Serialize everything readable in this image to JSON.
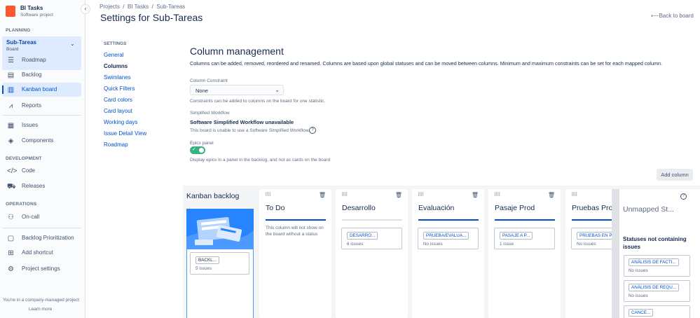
{
  "project": {
    "name": "BI Tasks",
    "type": "Software project"
  },
  "sidebar": {
    "planning_heading": "PLANNING",
    "board_name": "Sub-Tareas",
    "board_sub": "Board",
    "planning_items": [
      {
        "label": "Roadmap"
      },
      {
        "label": "Backlog"
      },
      {
        "label": "Kanban board"
      },
      {
        "label": "Reports"
      }
    ],
    "other_items": [
      {
        "label": "Issues"
      },
      {
        "label": "Components"
      }
    ],
    "development_heading": "DEVELOPMENT",
    "development_items": [
      {
        "label": "Code"
      },
      {
        "label": "Releases"
      }
    ],
    "operations_heading": "OPERATIONS",
    "operations_items": [
      {
        "label": "On-call"
      }
    ],
    "bottom_items": [
      {
        "label": "Backlog Prioritization"
      },
      {
        "label": "Add shortcut"
      },
      {
        "label": "Project settings"
      }
    ],
    "footer_text": "You're in a company-managed project",
    "learn_more": "Learn more"
  },
  "breadcrumbs": [
    "Projects",
    "BI Tasks",
    "Sub-Tareas"
  ],
  "page_title": "Settings for Sub-Tareas",
  "back_to_board": "Back to board",
  "settings_nav": {
    "heading": "SETTINGS",
    "items": [
      "General",
      "Columns",
      "Swimlanes",
      "Quick Filters",
      "Card colors",
      "Card layout",
      "Working days",
      "Issue Detail View",
      "Roadmap"
    ],
    "current": "Columns"
  },
  "content": {
    "heading": "Column management",
    "description": "Columns can be added, removed, reordered and renamed. Columns are based upon global statuses and can be moved between columns. Minimum and maximum constraints can be set for each mapped column.",
    "constraint_label": "Column Constraint",
    "constraint_value": "None",
    "constraint_help": "Constraints can be added to columns on the board for one statistic.",
    "workflow_label": "Simplified Workflow",
    "workflow_title": "Software Simplified Workflow unavailable",
    "workflow_help": "This board is unable to use a Software Simplified Workflow.",
    "epics_label": "Epics panel",
    "epics_enabled": true,
    "epics_help": "Display epics in a panel in the backlog, and not as cards on the board",
    "add_column": "Add column"
  },
  "board": {
    "backlog": {
      "title": "Kanban backlog",
      "status": "BACKL...",
      "count": "5 issues"
    },
    "columns": [
      {
        "title": "To Do",
        "note": "This column will not show on the board without a status"
      },
      {
        "title": "Desarrollo",
        "status": "DESARRO...",
        "count": "6 issues"
      },
      {
        "title": "Evaluación",
        "status": "PRUEBA/EVALUA...",
        "count": "No issues"
      },
      {
        "title": "Pasaje Prod",
        "status": "PASAJE A P...",
        "count": "1 issue"
      },
      {
        "title": "Pruebas Prod",
        "status": "PRUEBAS EN P...",
        "count": "No issues"
      }
    ],
    "unmapped": {
      "title": "Unmapped St...",
      "subtitle": "Statuses not containing issues",
      "statuses": [
        {
          "status": "ANÁLISIS DE FACTI...",
          "count": "No issues"
        },
        {
          "status": "ANÁLISIS DE REQU...",
          "count": "No issues"
        },
        {
          "status": "CANCE...",
          "count": ""
        }
      ]
    }
  },
  "icons": {
    "drag": "drag-handle-icon",
    "trash": "trash-icon",
    "help": "question-icon"
  },
  "colors": {
    "accent": "#0052cc",
    "selected_bg": "#deebff",
    "toggle_on": "#36b37e",
    "project_icon": "#ff5630"
  }
}
